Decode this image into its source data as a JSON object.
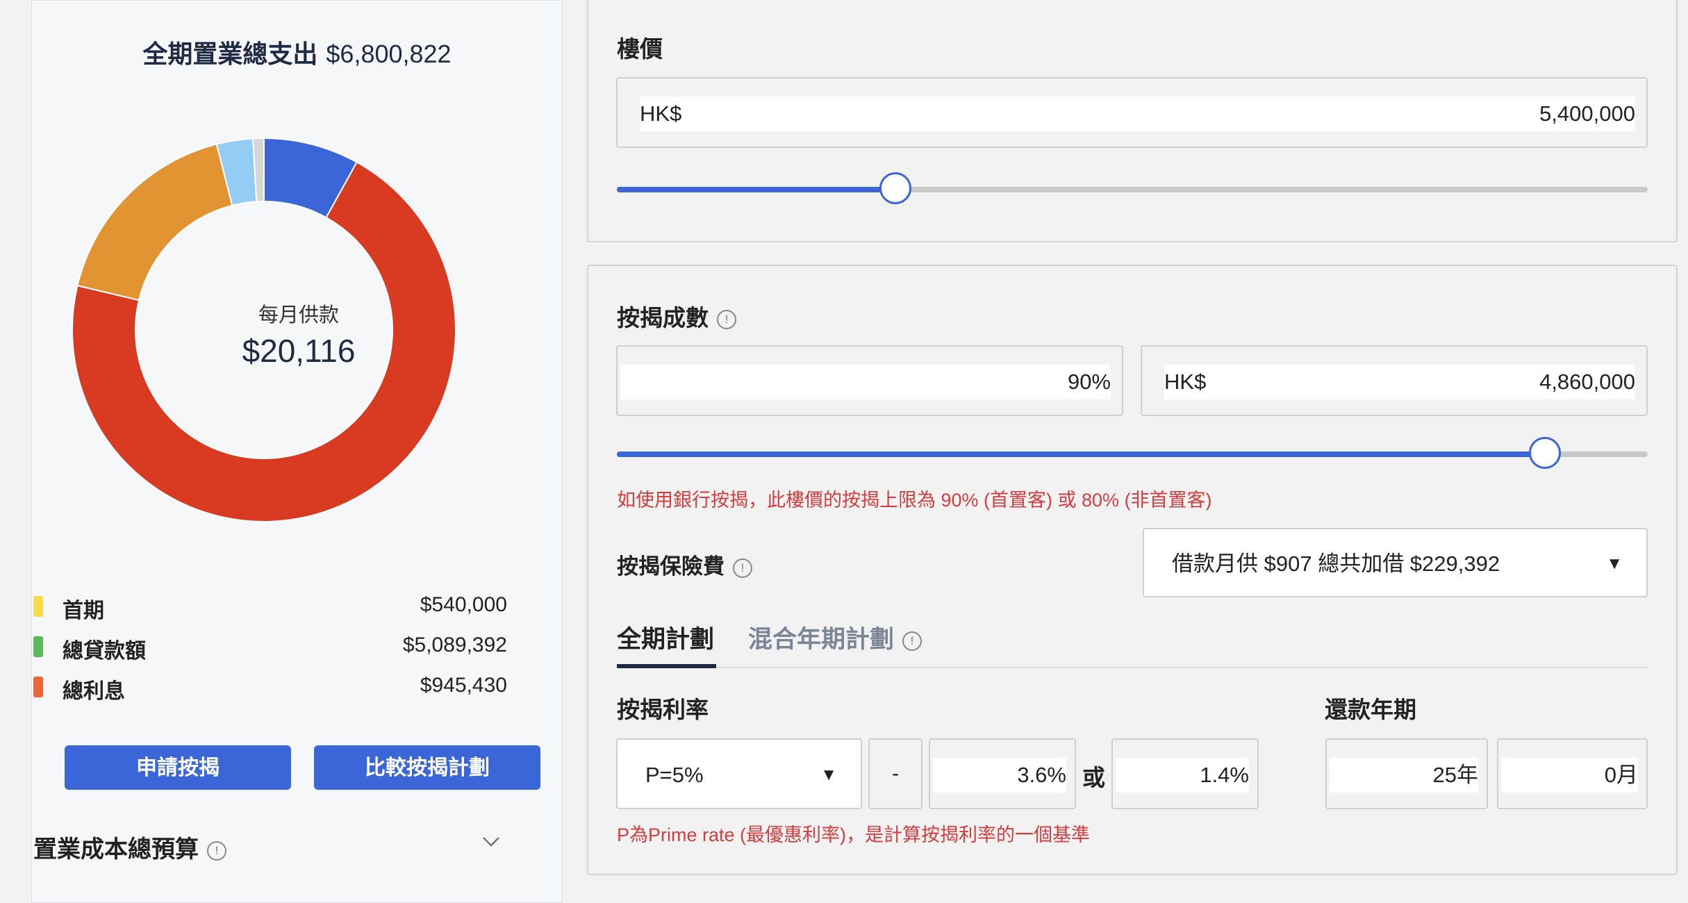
{
  "summary": {
    "total_label": "全期置業總支出",
    "total_value": "$6,800,822",
    "monthly_label": "每月供款",
    "monthly_value": "$20,116"
  },
  "donut_chart": {
    "segments": [
      {
        "name": "blue",
        "value": 7.9,
        "color": "#3a66d8"
      },
      {
        "name": "red",
        "value": 69.4,
        "color": "#d83a22"
      },
      {
        "name": "orange",
        "value": 17.0,
        "color": "#e39432"
      },
      {
        "name": "light-blue",
        "value": 3.0,
        "color": "#93cdf5"
      },
      {
        "name": "grey",
        "value": 0.9,
        "color": "#d6d6d6"
      }
    ]
  },
  "legend": [
    {
      "label": "首期",
      "value": "$540,000",
      "color": "#f5dc4a"
    },
    {
      "label": "總貸款額",
      "value": "$5,089,392",
      "color": "#5cb85c"
    },
    {
      "label": "總利息",
      "value": "$945,430",
      "color": "#e8683a"
    }
  ],
  "buttons": {
    "apply": "申請按揭",
    "compare": "比較按揭計劃"
  },
  "budget": {
    "label": "置業成本總預算",
    "info_icon": "info-icon",
    "chevron": "chevron-down-icon"
  },
  "price": {
    "label": "樓價",
    "currency": "HK$",
    "value": "5,400,000",
    "slider_fraction": 0.27
  },
  "mortgage_ratio": {
    "label": "按揭成數",
    "percent": "90%",
    "currency": "HK$",
    "amount": "4,860,000",
    "slider_fraction": 0.9,
    "warning": "如使用銀行按揭，此樓價的按揭上限為 90% (首置客) 或 80% (非首置客)"
  },
  "insurance": {
    "label": "按揭保險費",
    "selected": "借款月供 $907 總共加借 $229,392"
  },
  "tabs": [
    {
      "label": "全期計劃",
      "active": true
    },
    {
      "label": "混合年期計劃",
      "active": false
    }
  ],
  "interest": {
    "label": "按揭利率",
    "prime_select": "P=5%",
    "operator": "-",
    "spread": "3.6%",
    "or_label": "或",
    "rate": "1.4%",
    "note": "P為Prime rate (最優惠利率)，是計算按揭利率的一個基準"
  },
  "tenor": {
    "label": "還款年期",
    "years": "25年",
    "months": "0月"
  }
}
